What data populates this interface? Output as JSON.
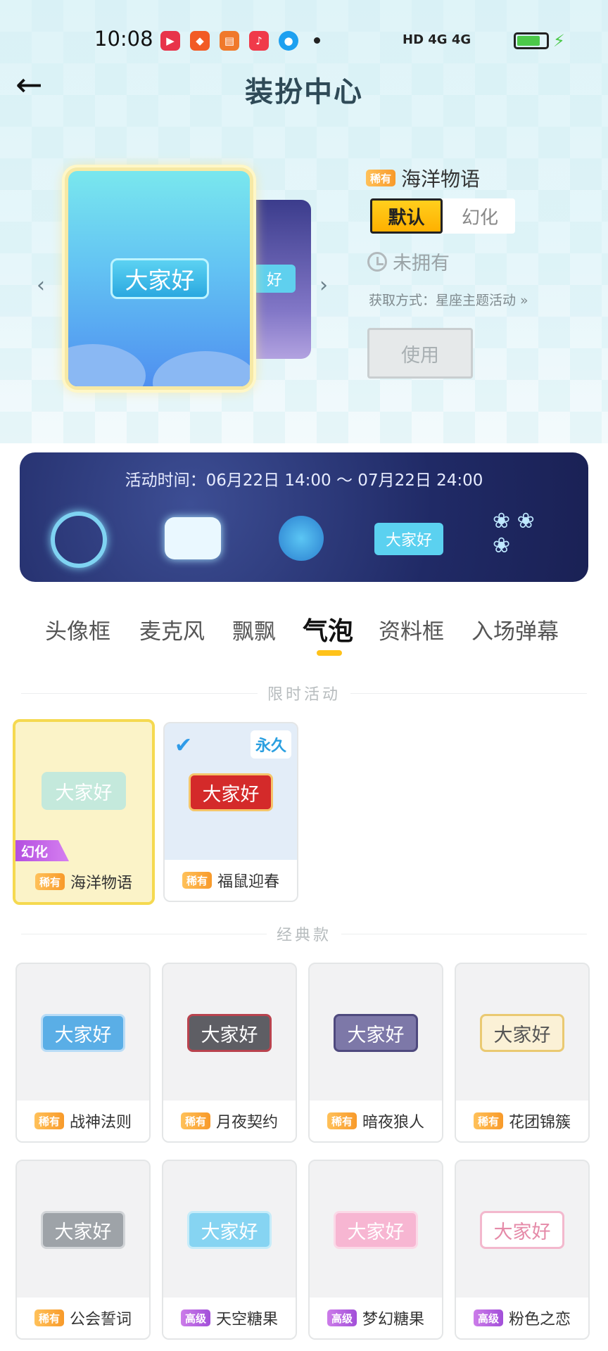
{
  "status_bar": {
    "time": "10:08",
    "app_icons": [
      "video-app-icon",
      "game-app-icon",
      "book-app-icon",
      "music-app-icon",
      "qq-app-icon"
    ],
    "network": "HD 4G 4G",
    "battery": "battery-icon"
  },
  "header": {
    "title": "装扮中心"
  },
  "preview": {
    "bubble_text": "大家好",
    "item_rarity": "稀有",
    "item_name": "海洋物语",
    "mode_default": "默认",
    "mode_alt": "幻化",
    "ownership": "未拥有",
    "obtain": "获取方式：星座主题活动 »",
    "use_label": "使用"
  },
  "banner": {
    "time": "活动时间：06月22日 14:00 ～ 07月22日 24:00",
    "bubble_text": "大家好"
  },
  "tabs": [
    "头像框",
    "麦克风",
    "飘飘",
    "气泡",
    "资料框",
    "入场弹幕"
  ],
  "active_tab": "气泡",
  "sections": {
    "limited": "限时活动",
    "classic": "经典款"
  },
  "limited_items": [
    {
      "rarity": "稀有",
      "name": "海洋物语",
      "bubble": "大家好",
      "tag": "幻化"
    },
    {
      "rarity": "稀有",
      "name": "福鼠迎春",
      "bubble": "大家好",
      "tag": "永久"
    }
  ],
  "classic_items": [
    {
      "rarity": "稀有",
      "name": "战神法则",
      "bubble": "大家好"
    },
    {
      "rarity": "稀有",
      "name": "月夜契约",
      "bubble": "大家好"
    },
    {
      "rarity": "稀有",
      "name": "暗夜狼人",
      "bubble": "大家好"
    },
    {
      "rarity": "稀有",
      "name": "花团锦簇",
      "bubble": "大家好"
    },
    {
      "rarity": "稀有",
      "name": "公会誓词",
      "bubble": "大家好"
    },
    {
      "rarity": "高级",
      "name": "天空糖果",
      "bubble": "大家好"
    },
    {
      "rarity": "高级",
      "name": "梦幻糖果",
      "bubble": "大家好"
    },
    {
      "rarity": "高级",
      "name": "粉色之恋",
      "bubble": "大家好"
    }
  ],
  "colors": {
    "accent": "#ffc21a",
    "rare": "#f89a2a",
    "advanced": "#a24fd9",
    "highlight": "#2a9fe0"
  }
}
